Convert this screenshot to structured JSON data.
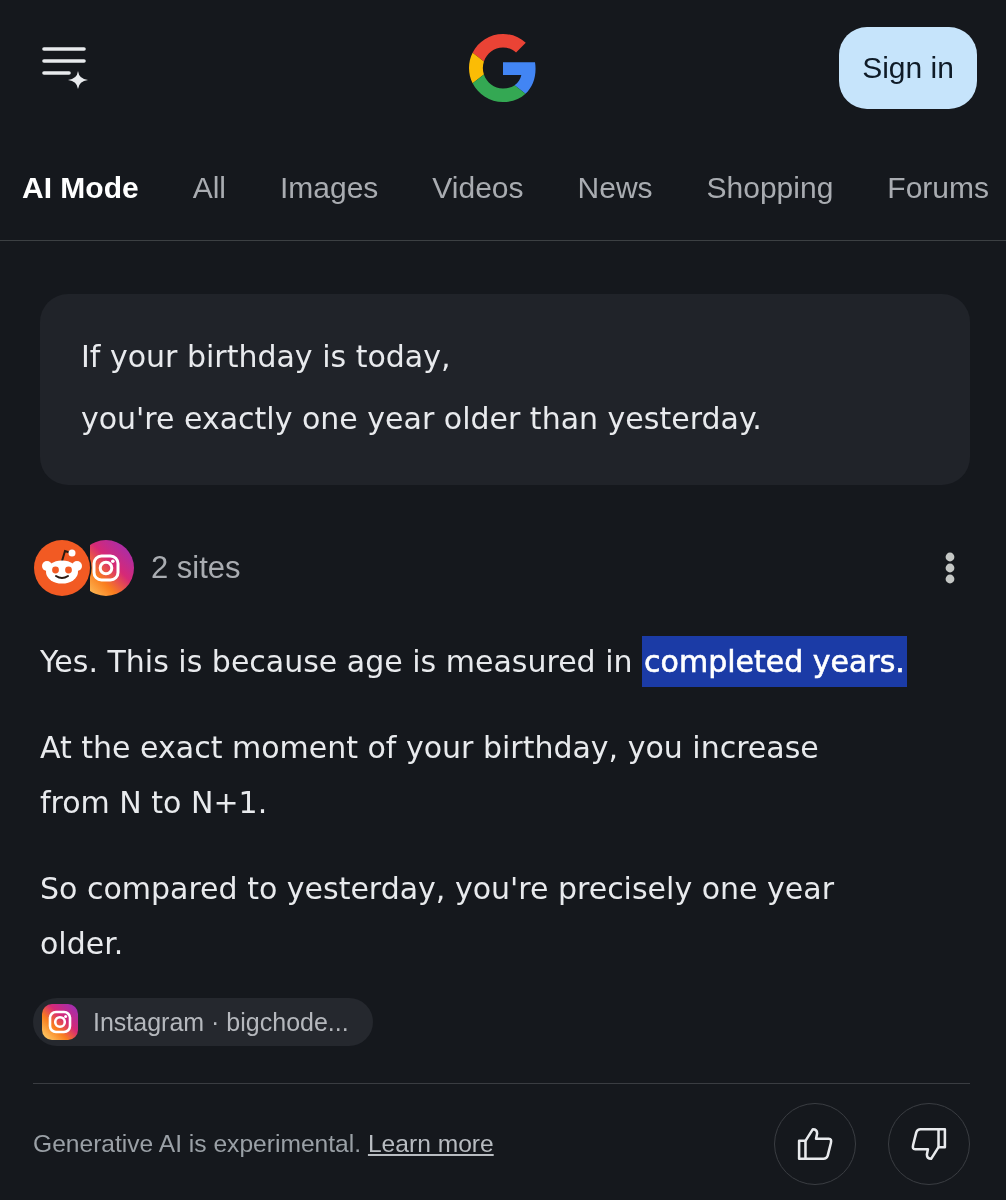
{
  "header": {
    "sign_in_button": "Sign in"
  },
  "tabs": [
    {
      "label": "AI Mode",
      "selected": true
    },
    {
      "label": "All",
      "selected": false
    },
    {
      "label": "Images",
      "selected": false
    },
    {
      "label": "Videos",
      "selected": false
    },
    {
      "label": "News",
      "selected": false
    },
    {
      "label": "Shopping",
      "selected": false
    },
    {
      "label": "Forums",
      "selected": false
    }
  ],
  "query": {
    "lines": [
      "If your birthday is today,",
      "you're exactly one year older than yesterday."
    ]
  },
  "sources": {
    "label": "2 sites"
  },
  "answer": {
    "paragraphs": [
      {
        "lines": [
          [
            {
              "text": "Yes. This is because age is measured in ",
              "highlighted": false
            },
            {
              "text": "completed years.",
              "highlighted": true
            }
          ]
        ]
      },
      {
        "lines": [
          [
            {
              "text": "At the exact moment of your birthday, you increase",
              "highlighted": false
            }
          ],
          [
            {
              "text": "from N to N+1.",
              "highlighted": false
            }
          ]
        ]
      },
      {
        "lines": [
          [
            {
              "text": "So compared to yesterday, you're precisely one year",
              "highlighted": false
            }
          ],
          [
            {
              "text": "older.",
              "highlighted": false
            }
          ]
        ]
      }
    ]
  },
  "source_chip": {
    "label": "Instagram · bigchode..."
  },
  "footer": {
    "disclaimer": "Generative AI is experimental. ",
    "link": "Learn more"
  }
}
